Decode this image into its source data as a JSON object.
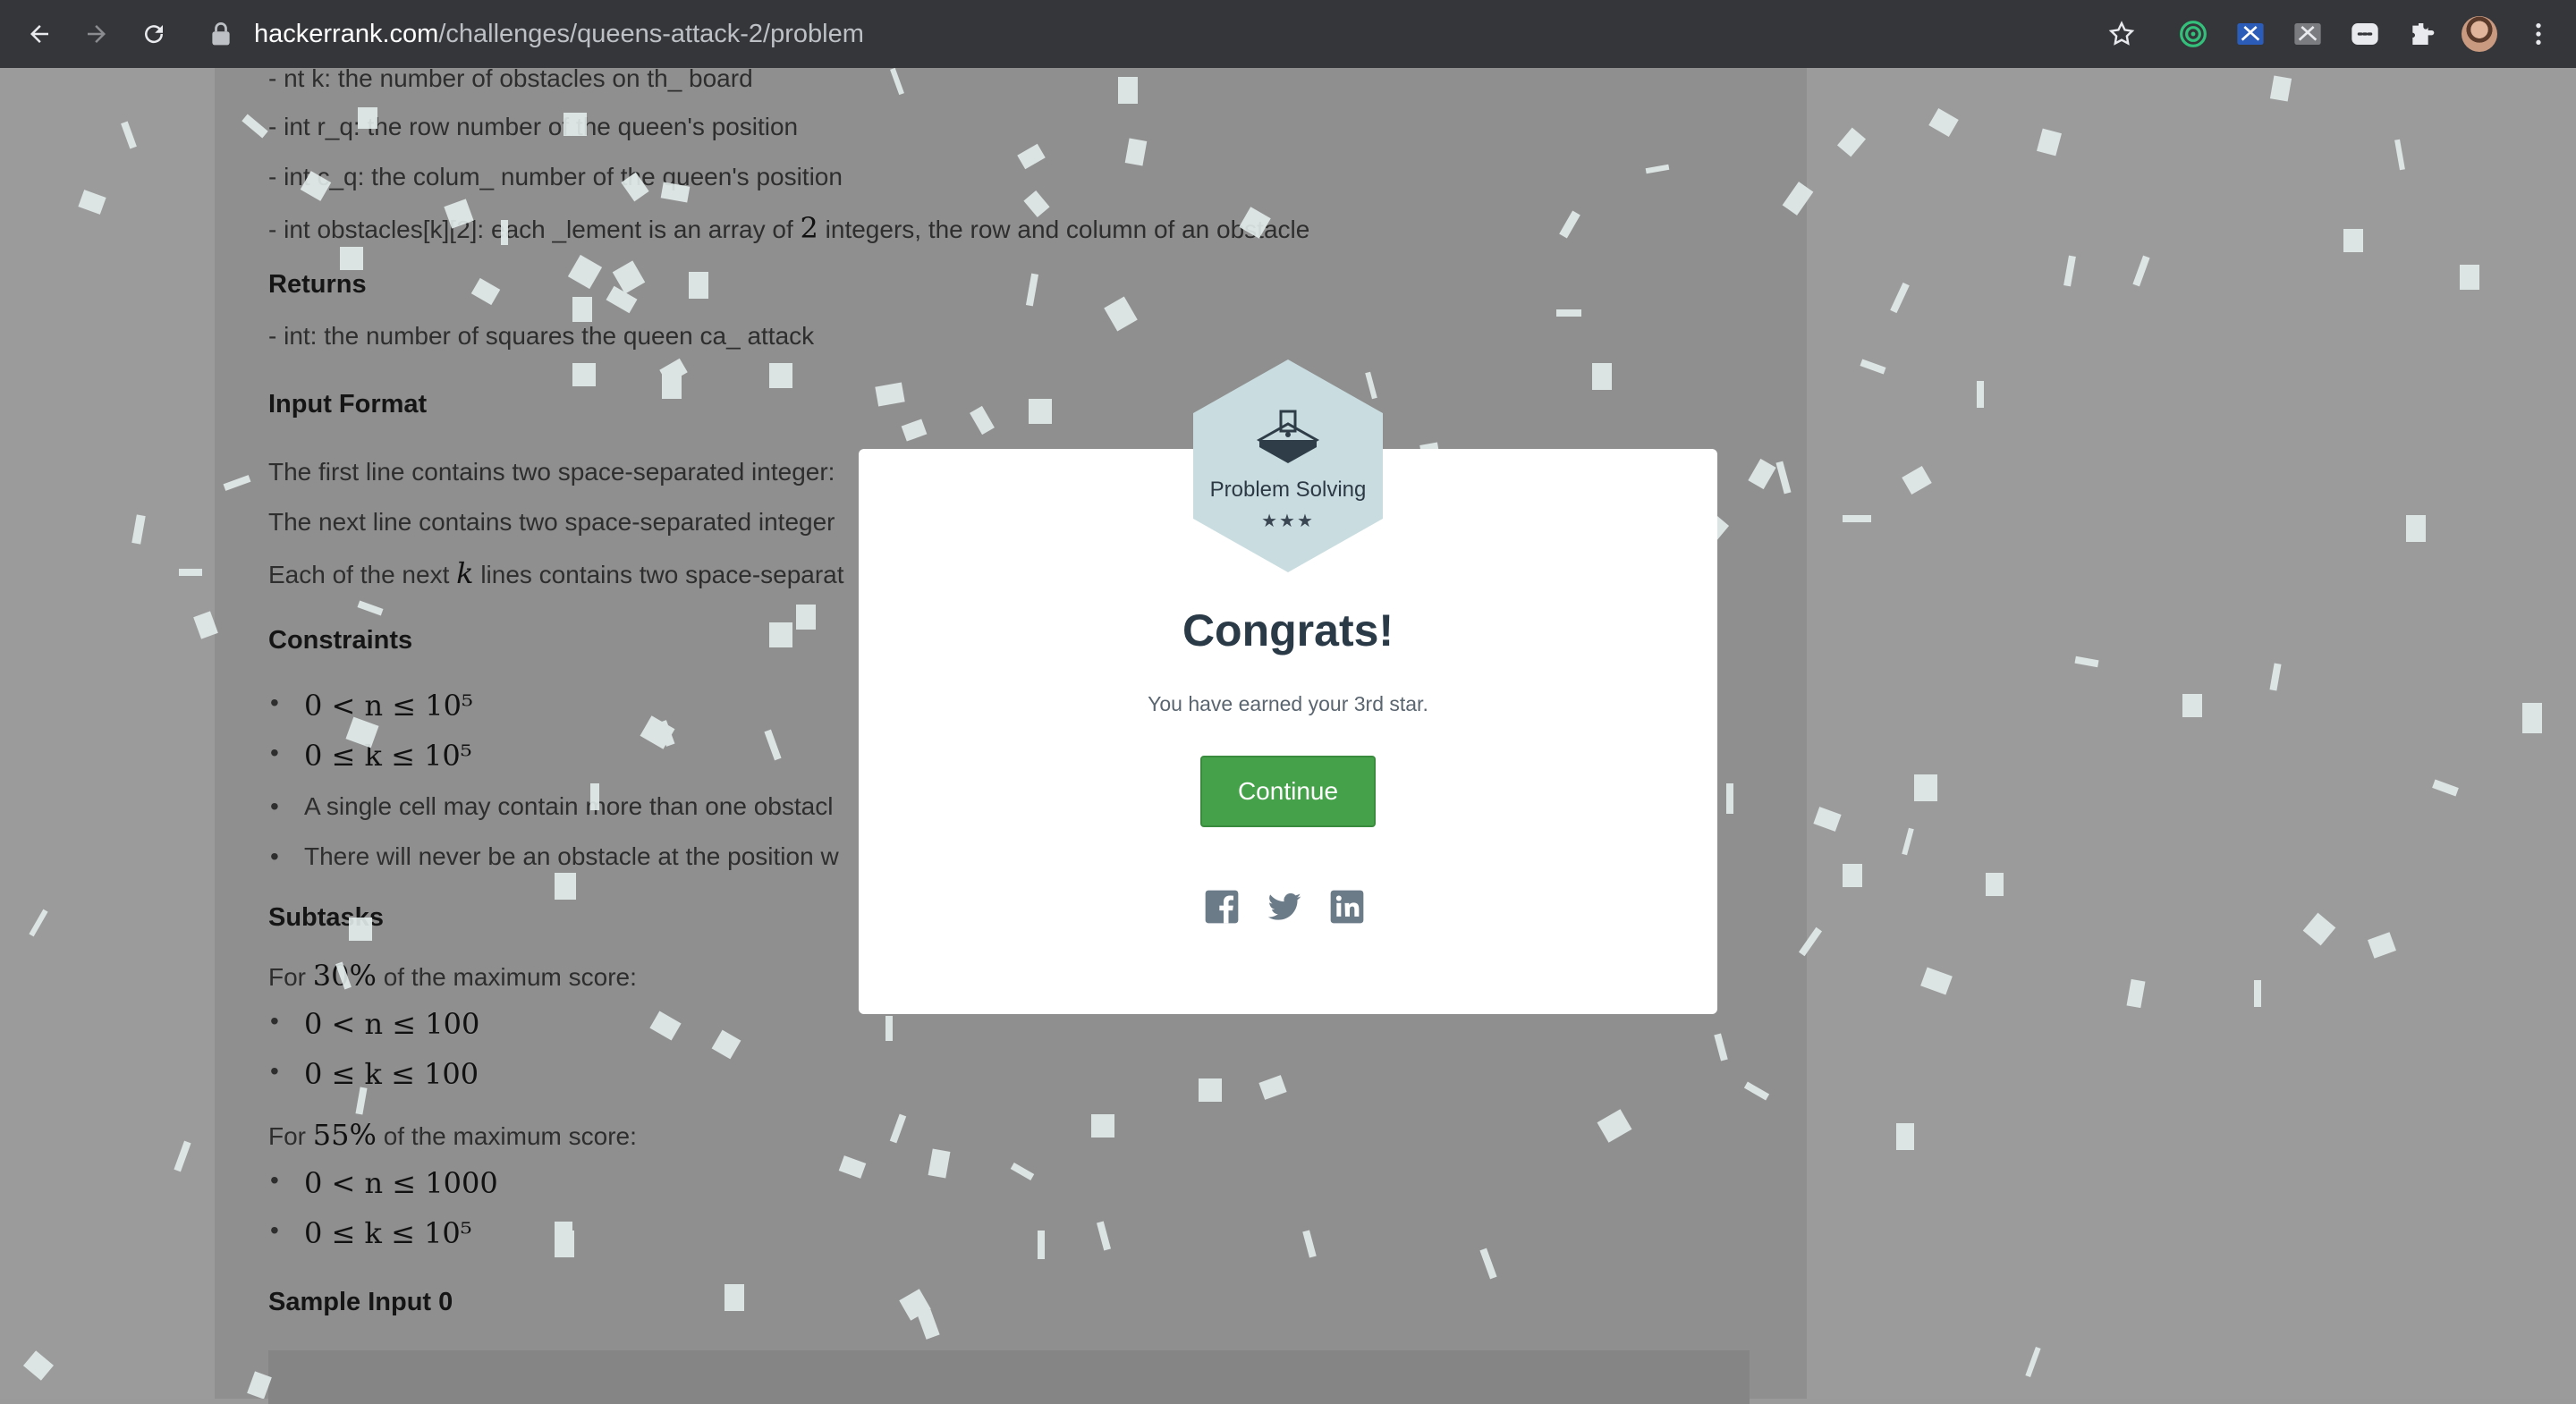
{
  "browser": {
    "url_host": "hackerrank.com",
    "url_path": "/challenges/queens-attack-2/problem"
  },
  "problem": {
    "param_k": "- nt k: the number of obstacles on th_ board",
    "param_rq": "- int r_q: the row number of the queen's position",
    "param_cq": "- int c_q: the colum_ number of the queen's position",
    "param_obs_prefix": "- int obstacles[k][2]: each _lement is an array of",
    "param_obs_num": "2",
    "param_obs_suffix": "integers, the row and column of an obstacle",
    "returns_heading": "Returns",
    "returns_text": "- int: the number of squares the queen ca_ attack",
    "input_heading": "Input Format",
    "input_line1": "The first line contains two space-separated integer:",
    "input_line2": "The next line contains two space-separated integer",
    "input_line3_prefix": "Each of the next",
    "input_line3_var": "k",
    "input_line3_suffix": "lines contains two space-separat",
    "constraints_heading": "Constraints",
    "constraints": [
      "0 < n ≤ 10⁵",
      "0 ≤ k ≤ 10⁵",
      "A single cell may contain more than one obstacl",
      "There will never be an obstacle at the position w"
    ],
    "subtasks_heading": "Subtasks",
    "subtask1_prefix": "For",
    "subtask1_pct": "30%",
    "subtask1_suffix": "of the maximum score:",
    "subtask1_items": [
      "0 < n ≤ 100",
      "0 ≤ k ≤ 100"
    ],
    "subtask2_prefix": "For",
    "subtask2_pct": "55%",
    "subtask2_suffix": "of the maximum score:",
    "subtask2_items": [
      "0 < n ≤ 1000",
      "0 ≤ k ≤ 10⁵"
    ],
    "sample_heading": "Sample Input 0"
  },
  "modal": {
    "badge_title": "Problem Solving",
    "badge_stars": "★★★",
    "heading": "Congrats!",
    "message": "You have earned your 3rd star.",
    "continue_label": "Continue"
  },
  "colors": {
    "continue_green": "#46a24a",
    "badge_fill": "#c9dde0",
    "social_icon": "#6b7b88"
  },
  "icons": [
    "back-icon",
    "forward-icon",
    "reload-icon",
    "lock-icon",
    "star-bookmark-icon",
    "extension-icon",
    "facebook-icon",
    "twitter-icon",
    "linkedin-icon"
  ]
}
